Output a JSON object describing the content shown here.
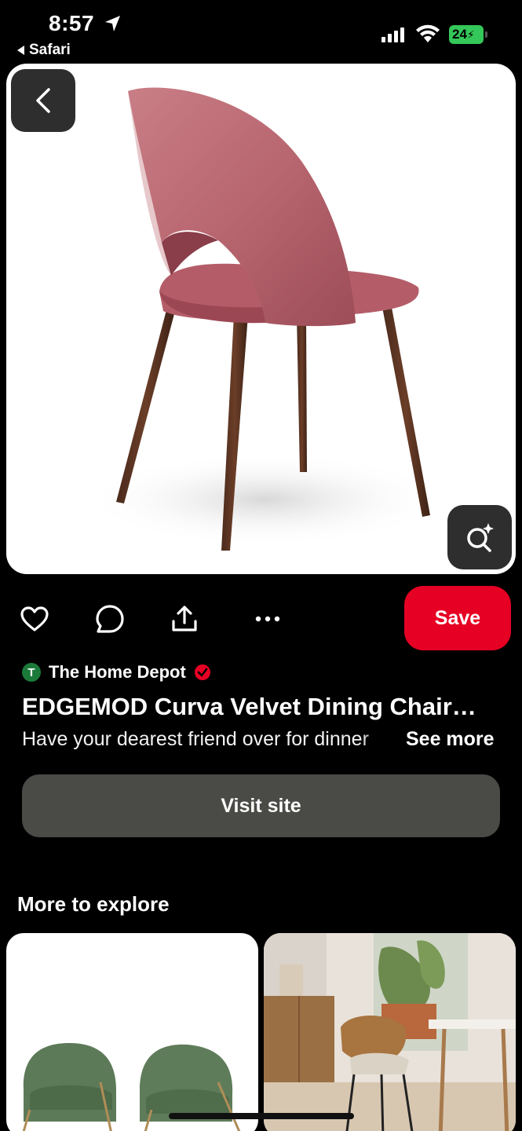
{
  "status_bar": {
    "time": "8:57",
    "back_app": "Safari",
    "battery": "24",
    "battery_color": "#34c759",
    "icons": [
      "location-arrow-icon",
      "signal-icon",
      "wifi-icon",
      "battery-icon"
    ]
  },
  "hero": {
    "image": "pink-velvet-dining-chair",
    "back_icon": "chevron-left-icon",
    "lens_icon": "visual-search-icon"
  },
  "actions": {
    "like_icon": "heart-icon",
    "comment_icon": "comment-icon",
    "share_icon": "share-icon",
    "more_icon": "more-icon",
    "save_label": "Save",
    "save_color": "#e60023"
  },
  "pin": {
    "creator_initial": "T",
    "creator_name": "The Home Depot",
    "verified_icon": "verified-badge-icon",
    "title": "EDGEMOD Curva Velvet Dining Chair…",
    "description": "Have your dearest friend over for dinner",
    "see_more": "See more",
    "visit_label": "Visit site"
  },
  "explore": {
    "title": "More to explore",
    "cards": [
      {
        "image": "green-dining-chairs"
      },
      {
        "image": "wood-dining-room-chair"
      }
    ]
  }
}
